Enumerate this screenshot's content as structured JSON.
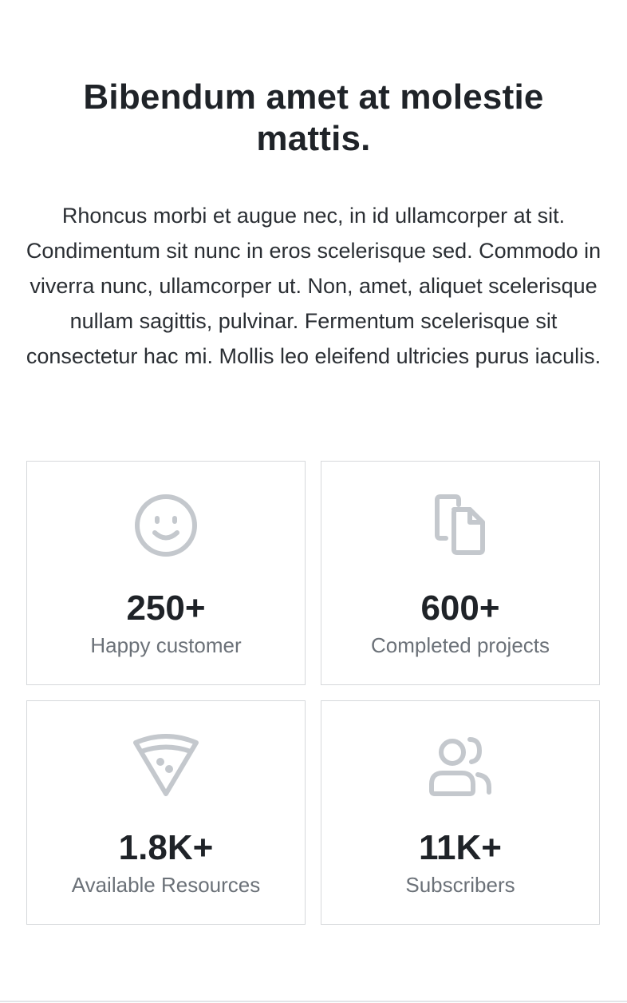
{
  "section": {
    "heading": "Bibendum amet at molestie mattis.",
    "description": "Rhoncus morbi et augue nec, in id ullamcorper at sit. Condimentum sit nunc in eros scelerisque sed. Commodo in viverra nunc, ullamcorper ut. Non, amet, aliquet scelerisque nullam sagittis, pulvinar. Fermentum scelerisque sit consectetur hac mi. Mollis leo eleifend ultricies purus iaculis."
  },
  "colors": {
    "text": "#1f2328",
    "muted": "#6b7178",
    "icon": "#c4c8cd",
    "border": "#d6d8db"
  },
  "stats": [
    {
      "icon": "smiley-face-icon",
      "value": "250+",
      "label": "Happy customer"
    },
    {
      "icon": "copy-documents-icon",
      "value": "600+",
      "label": "Completed projects"
    },
    {
      "icon": "pizza-slice-icon",
      "value": "1.8K+",
      "label": "Available Resources"
    },
    {
      "icon": "users-group-icon",
      "value": "11K+",
      "label": "Subscribers"
    }
  ]
}
